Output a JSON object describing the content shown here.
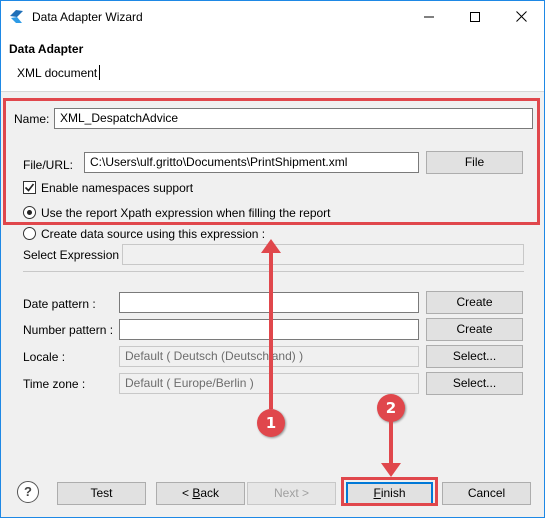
{
  "window": {
    "title": "Data Adapter Wizard"
  },
  "header": {
    "title": "Data Adapter",
    "subtitle": "XML document"
  },
  "form": {
    "name_label": "Name:",
    "name_value": "XML_DespatchAdvice",
    "file_label": "File/URL:",
    "file_value": "C:\\Users\\ulf.gritto\\Documents\\PrintShipment.xml",
    "file_button": "File",
    "namespaces_label": "Enable namespaces support",
    "namespaces_checked": true,
    "option_xpath_label": "Use the report Xpath expression when filling the report",
    "option_datasource_label": "Create data source using this expression :",
    "select_expression_label": "Select Expression :",
    "select_expression_value": "",
    "date_pattern_label": "Date pattern :",
    "date_pattern_value": "",
    "date_create_button": "Create",
    "number_pattern_label": "Number pattern :",
    "number_pattern_value": "",
    "number_create_button": "Create",
    "locale_label": "Locale :",
    "locale_value": "Default ( Deutsch (Deutschland) )",
    "locale_button": "Select...",
    "timezone_label": "Time zone :",
    "timezone_value": "Default ( Europe/Berlin )",
    "timezone_button": "Select..."
  },
  "footer": {
    "help": "?",
    "test": "Test",
    "back": "< Back",
    "next": "Next >",
    "finish": "Finish",
    "cancel": "Cancel"
  },
  "annotations": {
    "marker1": "1",
    "marker2": "2",
    "color": "#e0474c"
  }
}
